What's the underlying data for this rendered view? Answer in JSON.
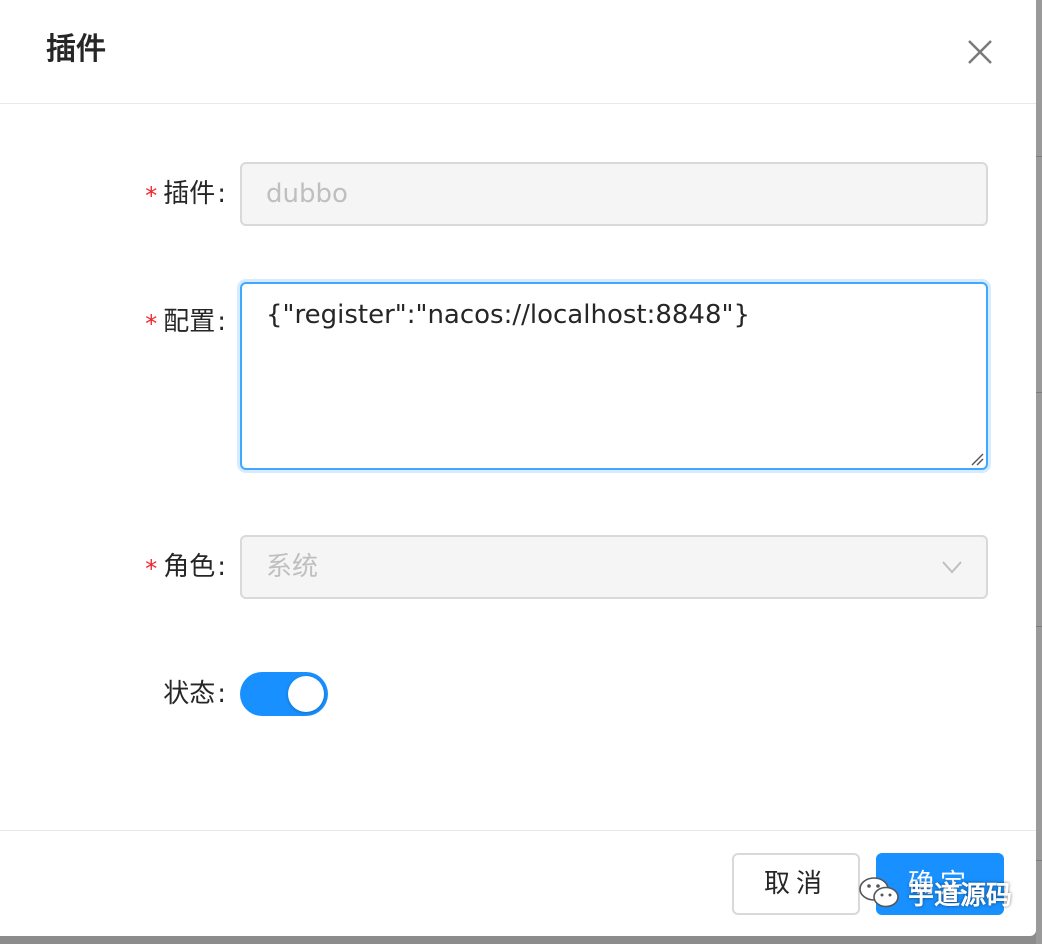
{
  "modal": {
    "title": "插件",
    "close_icon": "close-icon"
  },
  "form": {
    "plugin": {
      "label": "插件",
      "required": true,
      "value": "dubbo",
      "disabled": true
    },
    "config": {
      "label": "配置",
      "required": true,
      "value": "{\"register\":\"nacos://localhost:8848\"}"
    },
    "role": {
      "label": "角色",
      "required": true,
      "value": "系统",
      "disabled": true,
      "icon": "chevron-down-icon"
    },
    "status": {
      "label": "状态",
      "required": false,
      "enabled": true
    },
    "colon": ":",
    "required_mark": "*"
  },
  "footer": {
    "cancel_label": "取消",
    "ok_label": "确定"
  },
  "watermark": {
    "text": "芋道源码",
    "icon": "wechat-icon"
  },
  "colors": {
    "primary": "#1890ff",
    "required": "#f5222d",
    "disabled_bg": "#f5f5f5"
  }
}
